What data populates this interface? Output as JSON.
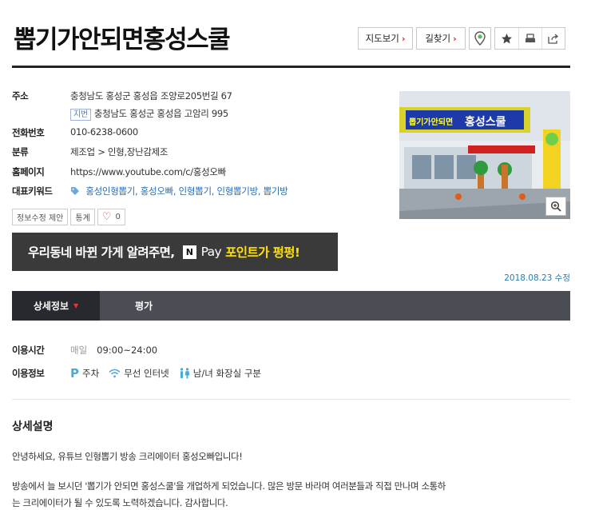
{
  "place": {
    "name": "뽑기가안되면홍성스쿨"
  },
  "toolbar": {
    "map_label": "지도보기",
    "route_label": "길찾기"
  },
  "info": {
    "address_label": "주소",
    "road_address": "충청남도 홍성군 홍성읍 조양로205번길 67",
    "jibun_badge": "지번",
    "jibun_address": "충청남도 홍성군 홍성읍 고암리 995",
    "phone_label": "전화번호",
    "phone": "010-6238-0600",
    "category_label": "분류",
    "category": "제조업 > 인형,장난감제조",
    "homepage_label": "홈페이지",
    "homepage": "https://www.youtube.com/c/홍성오빠",
    "keywords_label": "대표키워드",
    "keywords": [
      "홍성인형뽑기,",
      "홍성오빠,",
      "인형뽑기,",
      "인형뽑기방,",
      "뽑기방"
    ]
  },
  "actions": {
    "edit_label": "정보수정 제안",
    "stats_label": "통계",
    "like_count": "0"
  },
  "banner": {
    "text_before": "우리동네 바뀐 가게 알려주면,",
    "npay_mark": "N",
    "pay_text": "Pay",
    "highlight": "포인트가 펑펑!"
  },
  "photo": {
    "sign_part1": "뽑기가안되면",
    "sign_part2": "홍성스쿨"
  },
  "update_note": "2018.08.23 수정",
  "tabs": [
    {
      "label": "상세정보"
    },
    {
      "label": "평가"
    }
  ],
  "details": {
    "hours_label": "이용시간",
    "hours_day": "매일",
    "hours_time": "09:00~24:00",
    "amenities_label": "이용정보",
    "parking_mark": "P",
    "amenities": [
      "주차",
      "무선 인터넷",
      "남/녀 화장실 구분"
    ]
  },
  "description": {
    "title": "상세설명",
    "line1": "안녕하세요, 유튜브 인형뽑기 방송 크리에이터 홍성오빠입니다!",
    "line2": "방송에서 늘 보시던 '뽑기가 안되면 홍성스쿨'을 개업하게 되었습니다. 많은 방문 바라며 여러분들과 직접 만나며 소통하",
    "line3": "는 크리에이터가 될 수 있도록 노력하겠습니다. 감사합니다."
  },
  "colors": {
    "accent_red": "#dd2222",
    "link_teal": "#2a7a8c",
    "keyword_blue": "#2a6fb5",
    "tab_dark": "#27292e",
    "banner_yellow": "#ffe100"
  }
}
